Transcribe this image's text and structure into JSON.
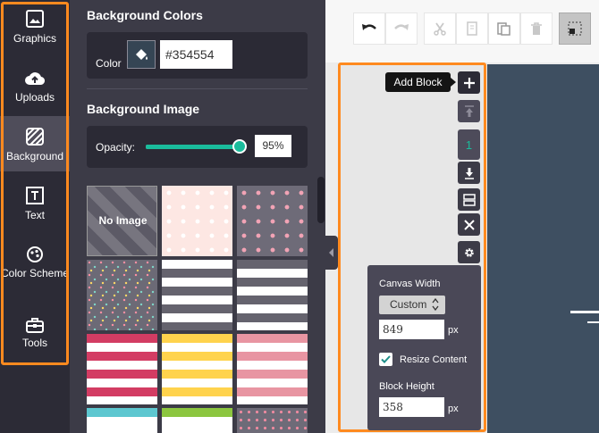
{
  "sidebar": {
    "items": [
      {
        "label": "Graphics",
        "icon": "image-icon"
      },
      {
        "label": "Uploads",
        "icon": "cloud-upload-icon"
      },
      {
        "label": "Background",
        "icon": "stripes-icon",
        "active": true
      },
      {
        "label": "Text",
        "icon": "text-box-icon"
      },
      {
        "label": "Color Scheme",
        "icon": "palette-icon"
      },
      {
        "label": "Tools",
        "icon": "toolbox-icon"
      }
    ]
  },
  "panel": {
    "bg_colors_title": "Background Colors",
    "color_label": "Color",
    "color_value": "#354554",
    "bg_image_title": "Background Image",
    "opacity_label": "Opacity:",
    "opacity_value": "95%",
    "opacity_level": 0.95,
    "no_image_label": "No Image"
  },
  "tooltip": "Add Block",
  "block_number": "1",
  "settings": {
    "canvas_width_label": "Canvas Width",
    "mode": "Custom",
    "width": "849",
    "width_unit": "px",
    "resize_label": "Resize Content",
    "resize_checked": true,
    "block_height_label": "Block Height",
    "height": "358",
    "height_unit": "px"
  },
  "colors": {
    "accent": "#ff8a1f",
    "teal": "#1abc9c",
    "canvas": "#3e4f61"
  }
}
